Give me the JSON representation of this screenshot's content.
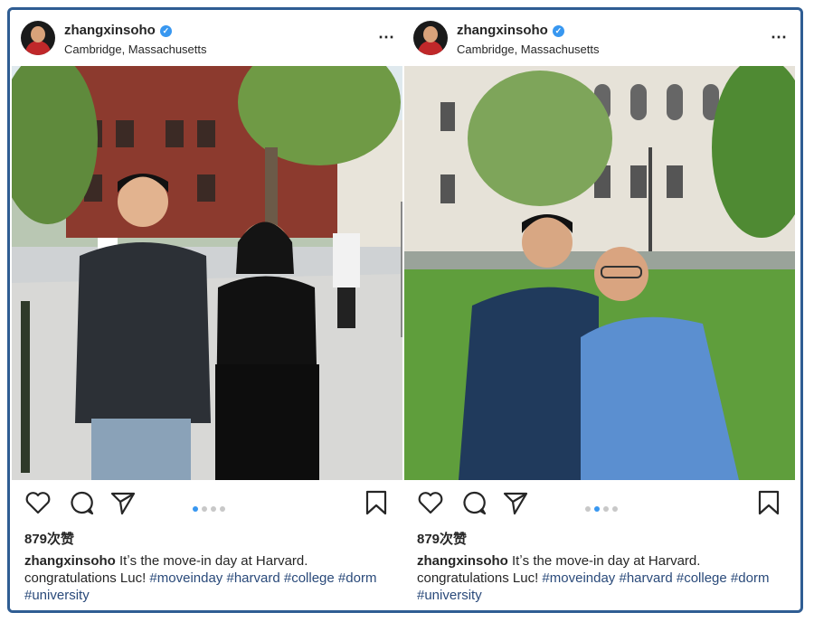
{
  "posts": [
    {
      "username": "zhangxinsoho",
      "location": "Cambridge, Massachusetts",
      "more_icon": "⋯",
      "likes": "879次赞",
      "caption_user": "zhangxinsoho",
      "caption_text": " Itʼs the move-in day at Harvard. congratulations Luc! ",
      "hashtags": [
        "#moveinday",
        "#harvard",
        "#college",
        "#dorm",
        "#university"
      ],
      "carousel_active_index": 0,
      "carousel_count": 4
    },
    {
      "username": "zhangxinsoho",
      "location": "Cambridge, Massachusetts",
      "more_icon": "⋯",
      "likes": "879次赞",
      "caption_user": "zhangxinsoho",
      "caption_text": " Itʼs the move-in day at Harvard. congratulations Luc! ",
      "hashtags": [
        "#moveinday",
        "#harvard",
        "#college",
        "#dorm",
        "#university"
      ],
      "carousel_active_index": 1,
      "carousel_count": 4
    }
  ],
  "colors": {
    "frame": "#2f5d93",
    "verified": "#3897f0",
    "hashtag": "#2a4a7a",
    "active_dot": "#3897f0"
  }
}
